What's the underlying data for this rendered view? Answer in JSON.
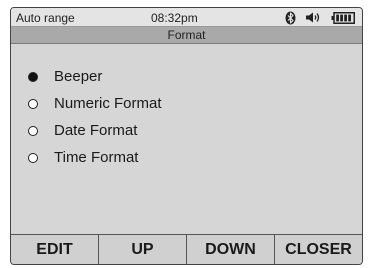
{
  "status_bar": {
    "range": "Auto range",
    "time": "08:32pm",
    "icons": [
      "bluetooth-icon",
      "speaker-icon",
      "battery-icon"
    ]
  },
  "title": "Format",
  "menu": {
    "selected_index": 0,
    "items": [
      {
        "label": "Beeper",
        "selected": true
      },
      {
        "label": "Numeric Format",
        "selected": false
      },
      {
        "label": "Date Format",
        "selected": false
      },
      {
        "label": "Time Format",
        "selected": false
      }
    ]
  },
  "softkeys": [
    {
      "label": "EDIT"
    },
    {
      "label": "UP"
    },
    {
      "label": "DOWN"
    },
    {
      "label": "CLOSER"
    }
  ]
}
